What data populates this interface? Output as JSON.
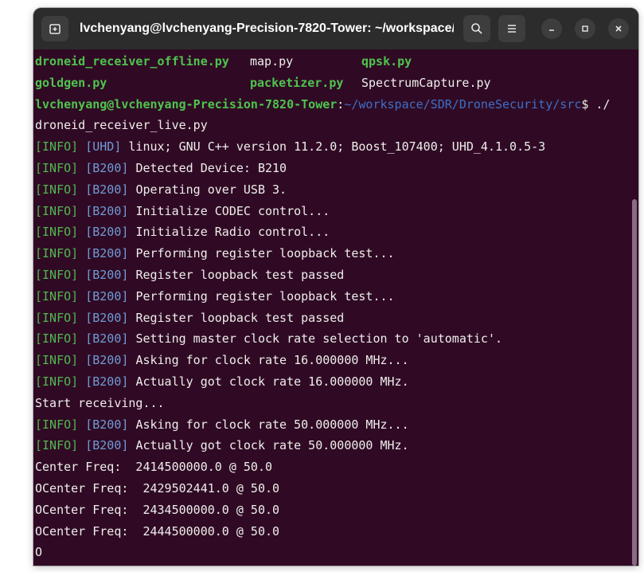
{
  "window": {
    "title": "lvchenyang@lvchenyang-Precision-7820-Tower: ~/workspace/...",
    "colors": {
      "background": "#300a24",
      "green": "#4ec44e",
      "path_blue": "#3e6fc7",
      "tag_blue": "#6f9bd6"
    }
  },
  "icons": {
    "new_tab": "new-tab-icon",
    "search": "search-icon",
    "menu": "hamburger-menu-icon",
    "minimize": "minimize-icon",
    "maximize": "maximize-icon",
    "close": "close-icon"
  },
  "terminal": {
    "listing": [
      [
        "droneid_receiver_offline.py",
        "map.py",
        "qpsk.py"
      ],
      [
        "goldgen.py",
        "packetizer.py",
        "SpectrumCapture.py"
      ]
    ],
    "prompt": {
      "user_host": "lvchenyang@lvchenyang-Precision-7820-Tower",
      "colon": ":",
      "path": "~/workspace/SDR/DroneSecurity/src",
      "symbol": "$",
      "command_part1": " ./",
      "command_part2": "droneid_receiver_live.py"
    },
    "log_a": [
      {
        "info": "[INFO]",
        "tag": "[UHD]",
        "msg": "linux; GNU C++ version 11.2.0; Boost_107400; UHD_4.1.0.5-3"
      },
      {
        "info": "[INFO]",
        "tag": "[B200]",
        "msg": "Detected Device: B210"
      },
      {
        "info": "[INFO]",
        "tag": "[B200]",
        "msg": "Operating over USB 3."
      },
      {
        "info": "[INFO]",
        "tag": "[B200]",
        "msg": "Initialize CODEC control..."
      },
      {
        "info": "[INFO]",
        "tag": "[B200]",
        "msg": "Initialize Radio control..."
      },
      {
        "info": "[INFO]",
        "tag": "[B200]",
        "msg": "Performing register loopback test..."
      },
      {
        "info": "[INFO]",
        "tag": "[B200]",
        "msg": "Register loopback test passed"
      },
      {
        "info": "[INFO]",
        "tag": "[B200]",
        "msg": "Performing register loopback test..."
      },
      {
        "info": "[INFO]",
        "tag": "[B200]",
        "msg": "Register loopback test passed"
      },
      {
        "info": "[INFO]",
        "tag": "[B200]",
        "msg": "Setting master clock rate selection to 'automatic'."
      },
      {
        "info": "[INFO]",
        "tag": "[B200]",
        "msg": "Asking for clock rate 16.000000 MHz..."
      },
      {
        "info": "[INFO]",
        "tag": "[B200]",
        "msg": "Actually got clock rate 16.000000 MHz."
      }
    ],
    "start_msg": "Start receiving...",
    "log_b": [
      {
        "info": "[INFO]",
        "tag": "[B200]",
        "msg": "Asking for clock rate 50.000000 MHz..."
      },
      {
        "info": "[INFO]",
        "tag": "[B200]",
        "msg": "Actually got clock rate 50.000000 MHz."
      }
    ],
    "output": [
      "Center Freq:  2414500000.0 @ 50.0",
      "OCenter Freq:  2429502441.0 @ 50.0",
      "OCenter Freq:  2434500000.0 @ 50.0",
      "OCenter Freq:  2444500000.0 @ 50.0",
      "O"
    ]
  }
}
